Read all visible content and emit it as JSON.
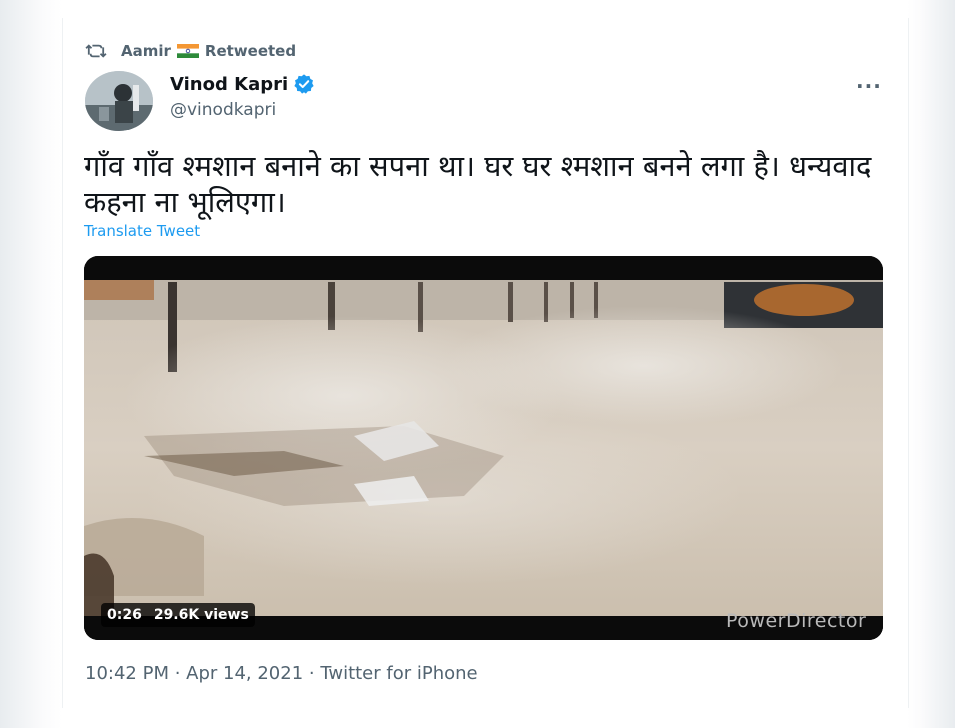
{
  "retweet": {
    "icon": "retweet-icon",
    "user": "Aamir",
    "flag_icon": "india-flag-icon",
    "label": "Retweeted"
  },
  "author": {
    "name": "Vinod Kapri",
    "verified_icon": "verified-badge-icon",
    "handle": "@vinodkapri",
    "more_icon": "more-options-icon",
    "more_label": "···"
  },
  "tweet": {
    "text": "गाँव गाँव श्मशान बनाने का सपना था। घर घर श्मशान बनने लगा है। धन्यवाद कहना ना भूलिएगा।",
    "translate_label": "Translate Tweet"
  },
  "video": {
    "duration": "0:26",
    "views": "29.6K views",
    "watermark": "PowerDirector"
  },
  "meta": {
    "timestamp": "10:42 PM · Apr 14, 2021 · Twitter for iPhone"
  },
  "colors": {
    "accent": "#1d9bf0",
    "secondary_text": "#536471",
    "primary_text": "#0f1419"
  }
}
